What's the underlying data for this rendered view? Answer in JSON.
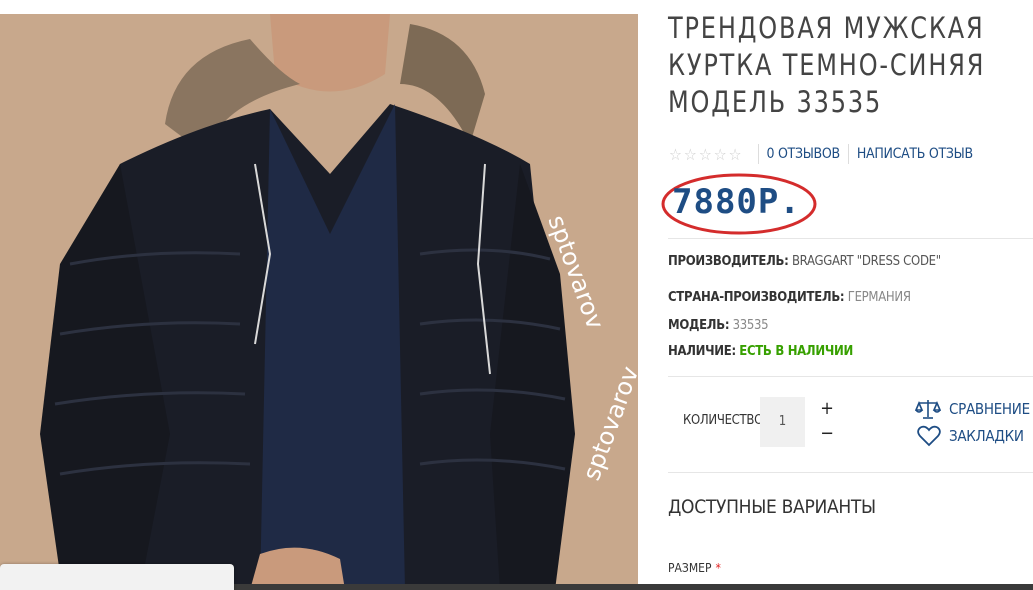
{
  "product": {
    "title": "ТРЕНДОВАЯ МУЖСКАЯ КУРТКА ТЕМНО-СИНЯЯ МОДЕЛЬ 33535",
    "rating_stars": 0,
    "reviews_link": "0 ОТЗЫВОВ",
    "write_review_link": "НАПИСАТЬ ОТЗЫВ",
    "price": "7880Р."
  },
  "specs": {
    "manufacturer_label": "ПРОИЗВОДИТЕЛЬ:",
    "manufacturer_value": "BRAGGART \"DRESS CODE\"",
    "country_label": "СТРАНА-ПРОИЗВОДИТЕЛЬ:",
    "country_value": "ГЕРМАНИЯ",
    "model_label": "МОДЕЛЬ:",
    "model_value": "33535",
    "stock_label": "НАЛИЧИЕ:",
    "stock_value": "ЕСТЬ В НАЛИЧИИ"
  },
  "quantity": {
    "label": "КОЛИЧЕСТВО",
    "value": "1",
    "plus": "+",
    "minus": "−"
  },
  "actions": {
    "compare": "СРАВНЕНИЕ",
    "bookmarks": "ЗАКЛАДКИ"
  },
  "options": {
    "section_title": "ДОСТУПНЫЕ ВАРИАНТЫ",
    "size_label": "РАЗМЕР",
    "required_mark": "*"
  },
  "watermark": "sptovarov",
  "colors": {
    "accent": "#1e4d84",
    "price_circle": "#d42c2c",
    "in_stock": "#37a000"
  }
}
